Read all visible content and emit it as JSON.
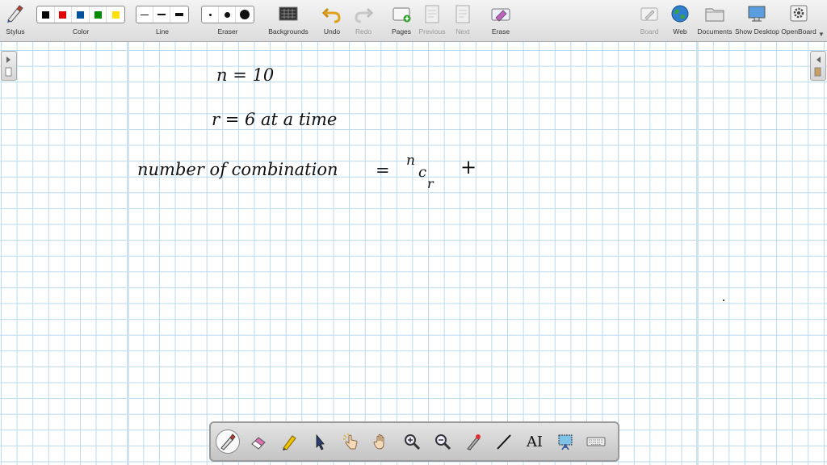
{
  "toolbar": {
    "stylus_label": "Stylus",
    "color_label": "Color",
    "line_label": "Line",
    "eraser_label": "Eraser",
    "backgrounds_label": "Backgrounds",
    "undo_label": "Undo",
    "redo_label": "Redo",
    "pages_label": "Pages",
    "previous_label": "Previous",
    "next_label": "Next",
    "erase_label": "Erase",
    "board_label": "Board",
    "web_label": "Web",
    "documents_label": "Documents",
    "show_desktop_label": "Show Desktop",
    "openboard_label": "OpenBoard",
    "colors": [
      "#000000",
      "#e00000",
      "#0050a0",
      "#008a00",
      "#ffe000"
    ]
  },
  "board": {
    "lines": [
      "n = 10",
      "r = 6 at a time"
    ],
    "formula_text": "number of combination",
    "formula_eq": "=",
    "formula_n": "n",
    "formula_c": "c",
    "formula_r": "r",
    "formula_plus": "+"
  },
  "palette": {
    "text_tool_glyph": "AI",
    "tools": [
      "pen-icon",
      "eraser-icon",
      "marker-icon",
      "selector-icon",
      "interact-icon",
      "hand-icon",
      "zoom-in-icon",
      "zoom-out-icon",
      "laser-pointer-icon",
      "line-icon",
      "text-icon",
      "capture-icon",
      "keyboard-icon"
    ]
  }
}
